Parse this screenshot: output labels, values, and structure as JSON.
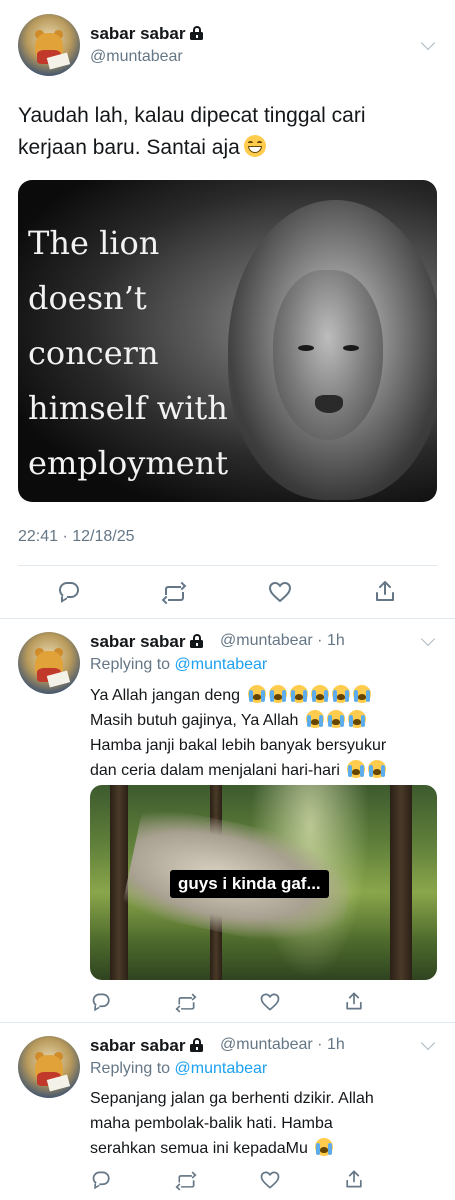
{
  "main_tweet": {
    "display_name": "sabar sabar",
    "handle": "@muntabear",
    "text_line1": "Yaudah lah, kalau dipecat tinggal cari",
    "text_line2": "kerjaan baru. Santai aja",
    "image_caption_lines": [
      "The lion",
      "doesn’t",
      "concern",
      "himself with",
      "employment"
    ],
    "timestamp": "22:41 · 12/18/25"
  },
  "reply1": {
    "display_name": "sabar sabar",
    "handle_time": "@muntabear · 1h",
    "replying_prefix": "Replying to ",
    "replying_to": "@muntabear",
    "line1": "Ya Allah jangan deng",
    "line2": "Masih butuh gajinya, Ya Allah",
    "line3": "Hamba janji bakal lebih banyak bersyukur",
    "line4": "dan ceria dalam menjalani hari-hari",
    "image_caption": "guys i kinda gaf..."
  },
  "reply2": {
    "display_name": "sabar sabar",
    "handle_time": "@muntabear · 1h",
    "replying_prefix": "Replying to ",
    "replying_to": "@muntabear",
    "line1": "Sepanjang jalan ga berhenti dzikir. Allah",
    "line2": "maha pembolak-balik hati. Hamba",
    "line3": "serahkan semua ini kepadaMu"
  },
  "icons": {
    "lock": "lock-icon",
    "chevron": "chevron-down-icon",
    "reply": "reply-icon",
    "retweet": "retweet-icon",
    "like": "heart-icon",
    "share": "share-icon",
    "grin": "grinning-face-emoji",
    "cry": "loudly-crying-face-emoji"
  },
  "colors": {
    "text": "#14171a",
    "secondary": "#657786",
    "link": "#1da1f2",
    "divider": "#e1e8ed"
  }
}
